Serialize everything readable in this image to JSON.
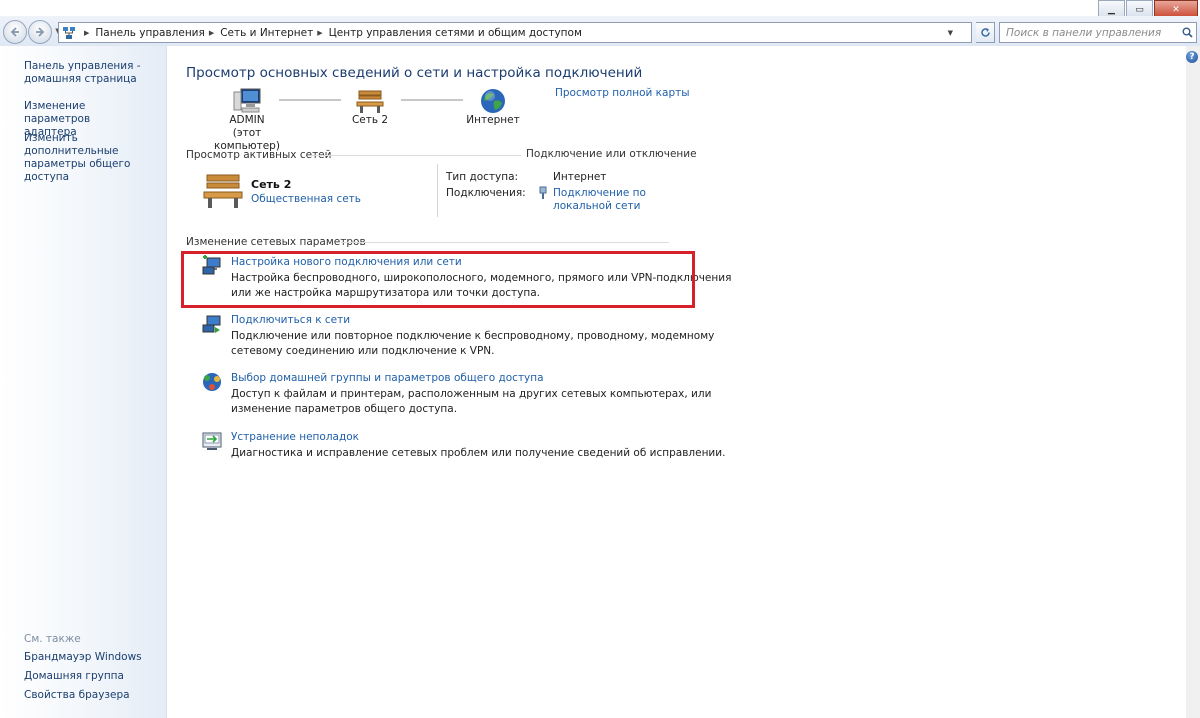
{
  "window": {
    "minimize_icon": "minimize-icon",
    "maximize_icon": "maximize-icon",
    "close_icon": "close-icon",
    "close_glyph": "✕",
    "minimize_glyph": "▁",
    "maximize_glyph": "▭"
  },
  "address_bar": {
    "crumbs": [
      "Панель управления",
      "Сеть и Интернет",
      "Центр управления сетями и общим доступом"
    ],
    "search_placeholder": "Поиск в панели управления"
  },
  "sidebar": {
    "links": [
      {
        "label": "Панель управления - домашняя страница"
      },
      {
        "label": "Изменение параметров адаптера"
      },
      {
        "label": "Изменить дополнительные параметры общего доступа"
      }
    ],
    "see_also_label": "См. также",
    "see_also": [
      {
        "label": "Брандмауэр Windows"
      },
      {
        "label": "Домашняя группа"
      },
      {
        "label": "Свойства браузера"
      }
    ]
  },
  "main": {
    "title": "Просмотр основных сведений о сети и настройка подключений",
    "full_map_link": "Просмотр полной карты",
    "map_nodes": {
      "computer": {
        "name": "ADMIN",
        "subtitle": "(этот компьютер)"
      },
      "network": {
        "name": "Сеть  2"
      },
      "internet": {
        "name": "Интернет"
      }
    },
    "active_networks": {
      "header": "Просмотр активных сетей",
      "connect_link": "Подключение или отключение",
      "network_name": "Сеть  2",
      "network_type": "Общественная сеть",
      "access_type_label": "Тип доступа:",
      "access_type_value": "Интернет",
      "connections_label": "Подключения:",
      "connection_value_line1": "Подключение по",
      "connection_value_line2": "локальной сети"
    },
    "change_settings": {
      "header": "Изменение сетевых параметров",
      "tasks": [
        {
          "title": "Настройка нового подключения или сети",
          "desc_line1": "Настройка беспроводного, широкополосного, модемного, прямого или VPN-подключения",
          "desc_line2": "или же настройка маршрутизатора или точки доступа.",
          "highlighted": true
        },
        {
          "title": "Подключиться к сети",
          "desc_line1": "Подключение или повторное подключение к беспроводному, проводному, модемному",
          "desc_line2": "сетевому соединению или подключение к VPN."
        },
        {
          "title": "Выбор домашней группы и параметров общего доступа",
          "desc_line1": "Доступ к файлам и принтерам, расположенным на других сетевых компьютерах, или",
          "desc_line2": "изменение параметров общего доступа."
        },
        {
          "title": "Устранение неполадок",
          "desc_line1": "Диагностика и исправление сетевых проблем или получение сведений об исправлении."
        }
      ]
    },
    "highlight_color": "#d6202a"
  },
  "help_glyph": "?"
}
